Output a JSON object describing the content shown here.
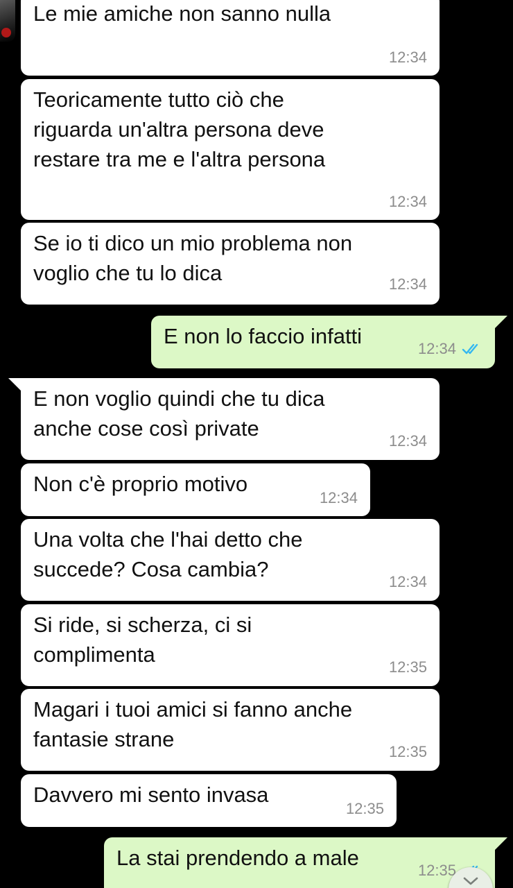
{
  "messages": [
    {
      "dir": "in",
      "text": "Le mie amiche non sanno nulla",
      "time": "12:34"
    },
    {
      "dir": "in",
      "text": "Teoricamente tutto ciò che\nriguarda un'altra persona deve\nrestare tra me e l'altra persona",
      "time": "12:34"
    },
    {
      "dir": "in",
      "text": "Se io ti dico un mio problema non\nvoglio che tu lo dica",
      "time": "12:34"
    },
    {
      "dir": "out",
      "text": "E non lo faccio infatti",
      "time": "12:34",
      "status": "read"
    },
    {
      "dir": "in",
      "text": "E non voglio quindi che tu dica\nanche cose così private",
      "time": "12:34"
    },
    {
      "dir": "in",
      "text": "Non c'è proprio motivo",
      "time": "12:34"
    },
    {
      "dir": "in",
      "text": "Una volta che l'hai detto che\nsuccede? Cosa cambia?",
      "time": "12:34"
    },
    {
      "dir": "in",
      "text": "Si ride, si scherza, ci si\ncomplimenta",
      "time": "12:35"
    },
    {
      "dir": "in",
      "text": "Magari i tuoi amici si fanno anche\nfantasie strane",
      "time": "12:35"
    },
    {
      "dir": "in",
      "text": "Davvero mi sento invasa",
      "time": "12:35"
    },
    {
      "dir": "out",
      "text": "La stai prendendo a male",
      "time": "12:35",
      "status": "read"
    }
  ],
  "colors": {
    "incoming_bubble": "#ffffff",
    "outgoing_bubble": "#dcf8c6",
    "timestamp": "#8c8c8c",
    "read_ticks": "#34b7f1",
    "background": "#000000"
  },
  "icons": {
    "read_receipt": "double-check-icon",
    "scroll_down": "chevron-down-icon"
  }
}
